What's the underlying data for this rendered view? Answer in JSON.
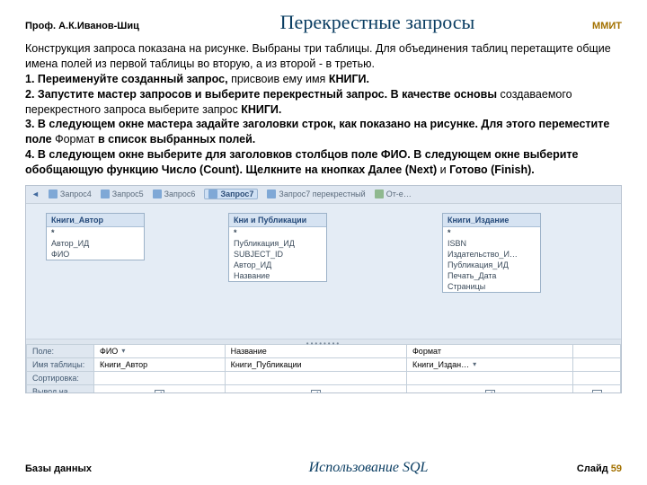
{
  "header": {
    "prof": "Проф. А.К.Иванов-Шиц",
    "title": "Перекрестные запросы",
    "right": "ММИТ"
  },
  "body": {
    "intro": "Конструкция запроса показана на рисунке. Выбраны три таблицы. Для объединения таблиц перетащите общие имена полей из первой таблицы во вторую, а из второй - в третью.",
    "step1": {
      "pre": "1. Переименуйте созданный запрос,",
      "post": "присвоив ему имя",
      "kw": "КНИГИ."
    },
    "step2": {
      "pre": "2. Запустите мастер запросов и выберите перекрестный запрос.",
      "mid": "В качестве  основы",
      "post": "создаваемого перекрестного запроса выберите запрос",
      "kw": "КНИГИ."
    },
    "step3": {
      "pre": "3. В следующем окне мастера задайте заголовки строк, как показано на рисунке. Для этого переместите поле",
      "txt": "Формат",
      "kw": "в список выбранных полей."
    },
    "step4": {
      "pre": "4. В следующем окне выберите для заголовков столбцов поле",
      "txt1": "",
      "kw1": "ФИО.",
      "txt2": "В следующем окне выберите обобщающую функцию",
      "kw2": "Число (Count).",
      "txt3": "Щелкните на кнопках",
      "kw3": "Далее (Next)",
      "txt4": "и",
      "kw4": "Готово (Finish)."
    }
  },
  "tabs": [
    "Запрос4",
    "Запрос5",
    "Запрос6",
    "Запрос7",
    "Запрос7 перекрестный",
    "От-е…"
  ],
  "tables": [
    {
      "title": "Книги_Автор",
      "fields": [
        "*",
        "Автор_ИД",
        "ФИО"
      ]
    },
    {
      "title": "Кни и Публикации",
      "fields": [
        "*",
        "Публикация_ИД",
        "SUBJECT_ID",
        "Автор_ИД",
        "Название"
      ]
    },
    {
      "title": "Книги_Издание",
      "fields": [
        "*",
        "ISBN",
        "Издательство_И…",
        "Публикация_ИД",
        "Печать_Дата",
        "Страницы"
      ]
    }
  ],
  "grid": {
    "rows": [
      "Поле:",
      "Имя таблицы:",
      "Сортировка:",
      "Вывод на экран:"
    ],
    "cols": [
      {
        "field": "ФИО",
        "table": "Книги_Автор"
      },
      {
        "field": "Название",
        "table": "Книги_Публикации"
      },
      {
        "field": "Формат",
        "table": "Книги_Издан…"
      }
    ]
  },
  "footer": {
    "left": "Базы данных",
    "center": "Использование SQL",
    "rlabel": "Слайд",
    "slide": "59"
  }
}
